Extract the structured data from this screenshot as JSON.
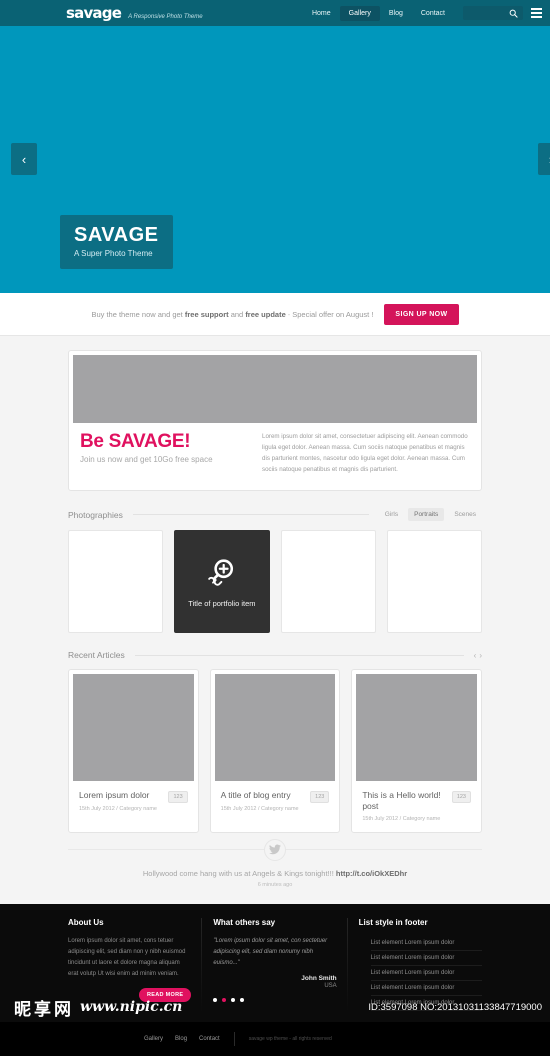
{
  "header": {
    "logo": "savage",
    "tagline": "A Responsive Photo Theme",
    "nav": [
      {
        "label": "Home",
        "active": false
      },
      {
        "label": "Gallery",
        "active": true
      },
      {
        "label": "Blog",
        "active": false
      },
      {
        "label": "Contact",
        "active": false
      }
    ],
    "search": {
      "value": "",
      "placeholder": ""
    },
    "icons": {
      "search": "search-icon",
      "menu": "hamburger-menu-icon"
    },
    "bg_color": "#0a6274"
  },
  "hero": {
    "bg_color": "#0097bc",
    "caption_bg": "#0c6e84",
    "title": "SAVAGE",
    "subtitle": "A Super Photo Theme",
    "prev_label": "‹",
    "next_label": "›"
  },
  "promo": {
    "text_before": "Buy the theme now and get ",
    "bold1": "free support",
    "text_middle": " and ",
    "bold2": "free update",
    "separator": "-",
    "text_after": "Special offer on August !",
    "button_label": "SIGN UP NOW",
    "button_color": "#d4145a"
  },
  "feature": {
    "title": "Be SAVAGE!",
    "title_color": "#e0115f",
    "subtitle": "Join us now and get 10Go free space",
    "paragraph": "Lorem ipsum dolor sit amet, consectetuer adipiscing elit. Aenean commodo ligula eget dolor. Aenean massa. Cum sociis natoque penatibus et magnis dis parturient montes, nascetur odo ligula eget dolor. Aenean massa. Cum sociis natoque penatibus et magnis dis parturient."
  },
  "portfolio": {
    "section_title": "Photographies",
    "filters": [
      {
        "label": "Girls",
        "active": false
      },
      {
        "label": "Portraits",
        "active": true
      },
      {
        "label": "Scenes",
        "active": false
      }
    ],
    "items": [
      {
        "hover": false,
        "caption": ""
      },
      {
        "hover": true,
        "caption": "Title of portfolio item"
      },
      {
        "hover": false,
        "caption": ""
      },
      {
        "hover": false,
        "caption": ""
      }
    ],
    "hover_icons": {
      "zoom": "magnifier-plus-icon",
      "link": "chain-link-icon"
    }
  },
  "articles": {
    "section_title": "Recent Articles",
    "prev_label": "‹",
    "next_label": "›",
    "items": [
      {
        "title": "Lorem ipsum dolor",
        "meta": "15th July 2012 / Category name",
        "badge": "123"
      },
      {
        "title": "A title of blog entry",
        "meta": "15th July 2012 / Category name",
        "badge": "123"
      },
      {
        "title": "This is a Hello world! post",
        "meta": "15th July 2012 / Category name",
        "badge": "123"
      }
    ]
  },
  "tweet": {
    "icon": "twitter-bird-icon",
    "text": "Hollywood come hang with us at Angels & Kings tonight!!! ",
    "link": "http://t.co/iOkXEDhr",
    "time": "6 minutes ago"
  },
  "footer": {
    "about": {
      "heading": "About Us",
      "body": "Lorem ipsum dolor sit amet, cons tetuer adipiscing elit, sed diam non y nibh euismod tincidunt ut laore et dolore magna aliquam erat volutp Ut wisi enim ad minim veniam.",
      "button_label": "READ MORE"
    },
    "testimonial": {
      "heading": "What others say",
      "quote": "\"Lorem ipsum dolor sit amet, con sectetuer adipiscing elit, sed diam nonumy nibh euismo...\"",
      "author": "John Smith",
      "location": "USA",
      "dots_count": 4,
      "active_dot": 1
    },
    "list": {
      "heading": "List style in footer",
      "items": [
        "List element Lorem ipsum dolor",
        "List element Lorem ipsum dolor",
        "List element Lorem ipsum dolor",
        "List element Lorem ipsum dolor",
        "List element Lorem ipsum dolor"
      ]
    }
  },
  "bottom": {
    "nav": [
      "Gallery",
      "Blog",
      "Contact"
    ],
    "copyright": "savage wp theme - all rights reserved"
  },
  "watermark": {
    "cn_text": "昵享网",
    "url": "www.nipic.cn",
    "id_text": "ID:3597098 NO:20131031133847719000"
  }
}
